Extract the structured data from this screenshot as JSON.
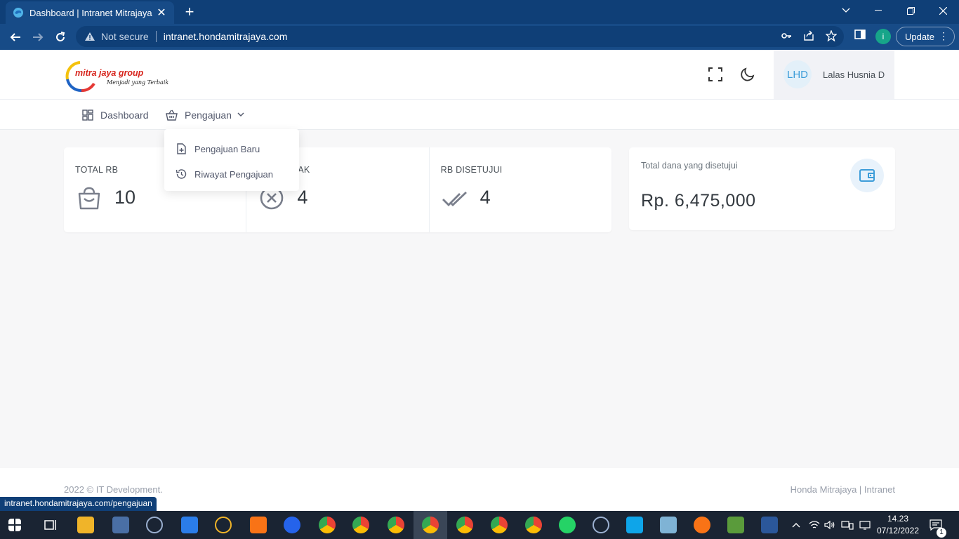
{
  "browser": {
    "tab_title": "Dashboard | Intranet Mitrajaya",
    "security_label": "Not secure",
    "url": "intranet.hondamitrajaya.com",
    "profile_initial": "i",
    "update_label": "Update",
    "status_url": "intranet.hondamitrajaya.com/pengajuan"
  },
  "header": {
    "logo_text": "mitra jaya group",
    "logo_tagline": "Menjadi yang Terbaik",
    "user_initials": "LHD",
    "user_name": "Lalas Husnia D"
  },
  "menu": {
    "dashboard": "Dashboard",
    "pengajuan": "Pengajuan"
  },
  "dropdown": {
    "items": [
      {
        "label": "Pengajuan Baru",
        "icon": "file-plus-icon"
      },
      {
        "label": "Riwayat Pengajuan",
        "icon": "history-icon"
      }
    ]
  },
  "stats": [
    {
      "label": "TOTAL RB",
      "value": "10",
      "icon": "basket-icon"
    },
    {
      "label": "AK",
      "value": "4",
      "icon": "x-circle-icon"
    },
    {
      "label": "RB DISETUJUI",
      "value": "4",
      "icon": "double-check-icon"
    }
  ],
  "fund": {
    "label": "Total dana yang disetujui",
    "value": "Rp. 6,475,000",
    "icon": "wallet-icon"
  },
  "footer": {
    "left": "2022 © IT Development.",
    "right": "Honda Mitrajaya | Intranet"
  },
  "taskbar": {
    "time": "14.23",
    "date": "07/12/2022",
    "notifications": "1"
  },
  "colors": {
    "browser_dark": "#0f3f77",
    "browser_toolbar": "#174b87",
    "accent_blue": "#3d9dd9",
    "page_bg": "#f7f7f8"
  }
}
